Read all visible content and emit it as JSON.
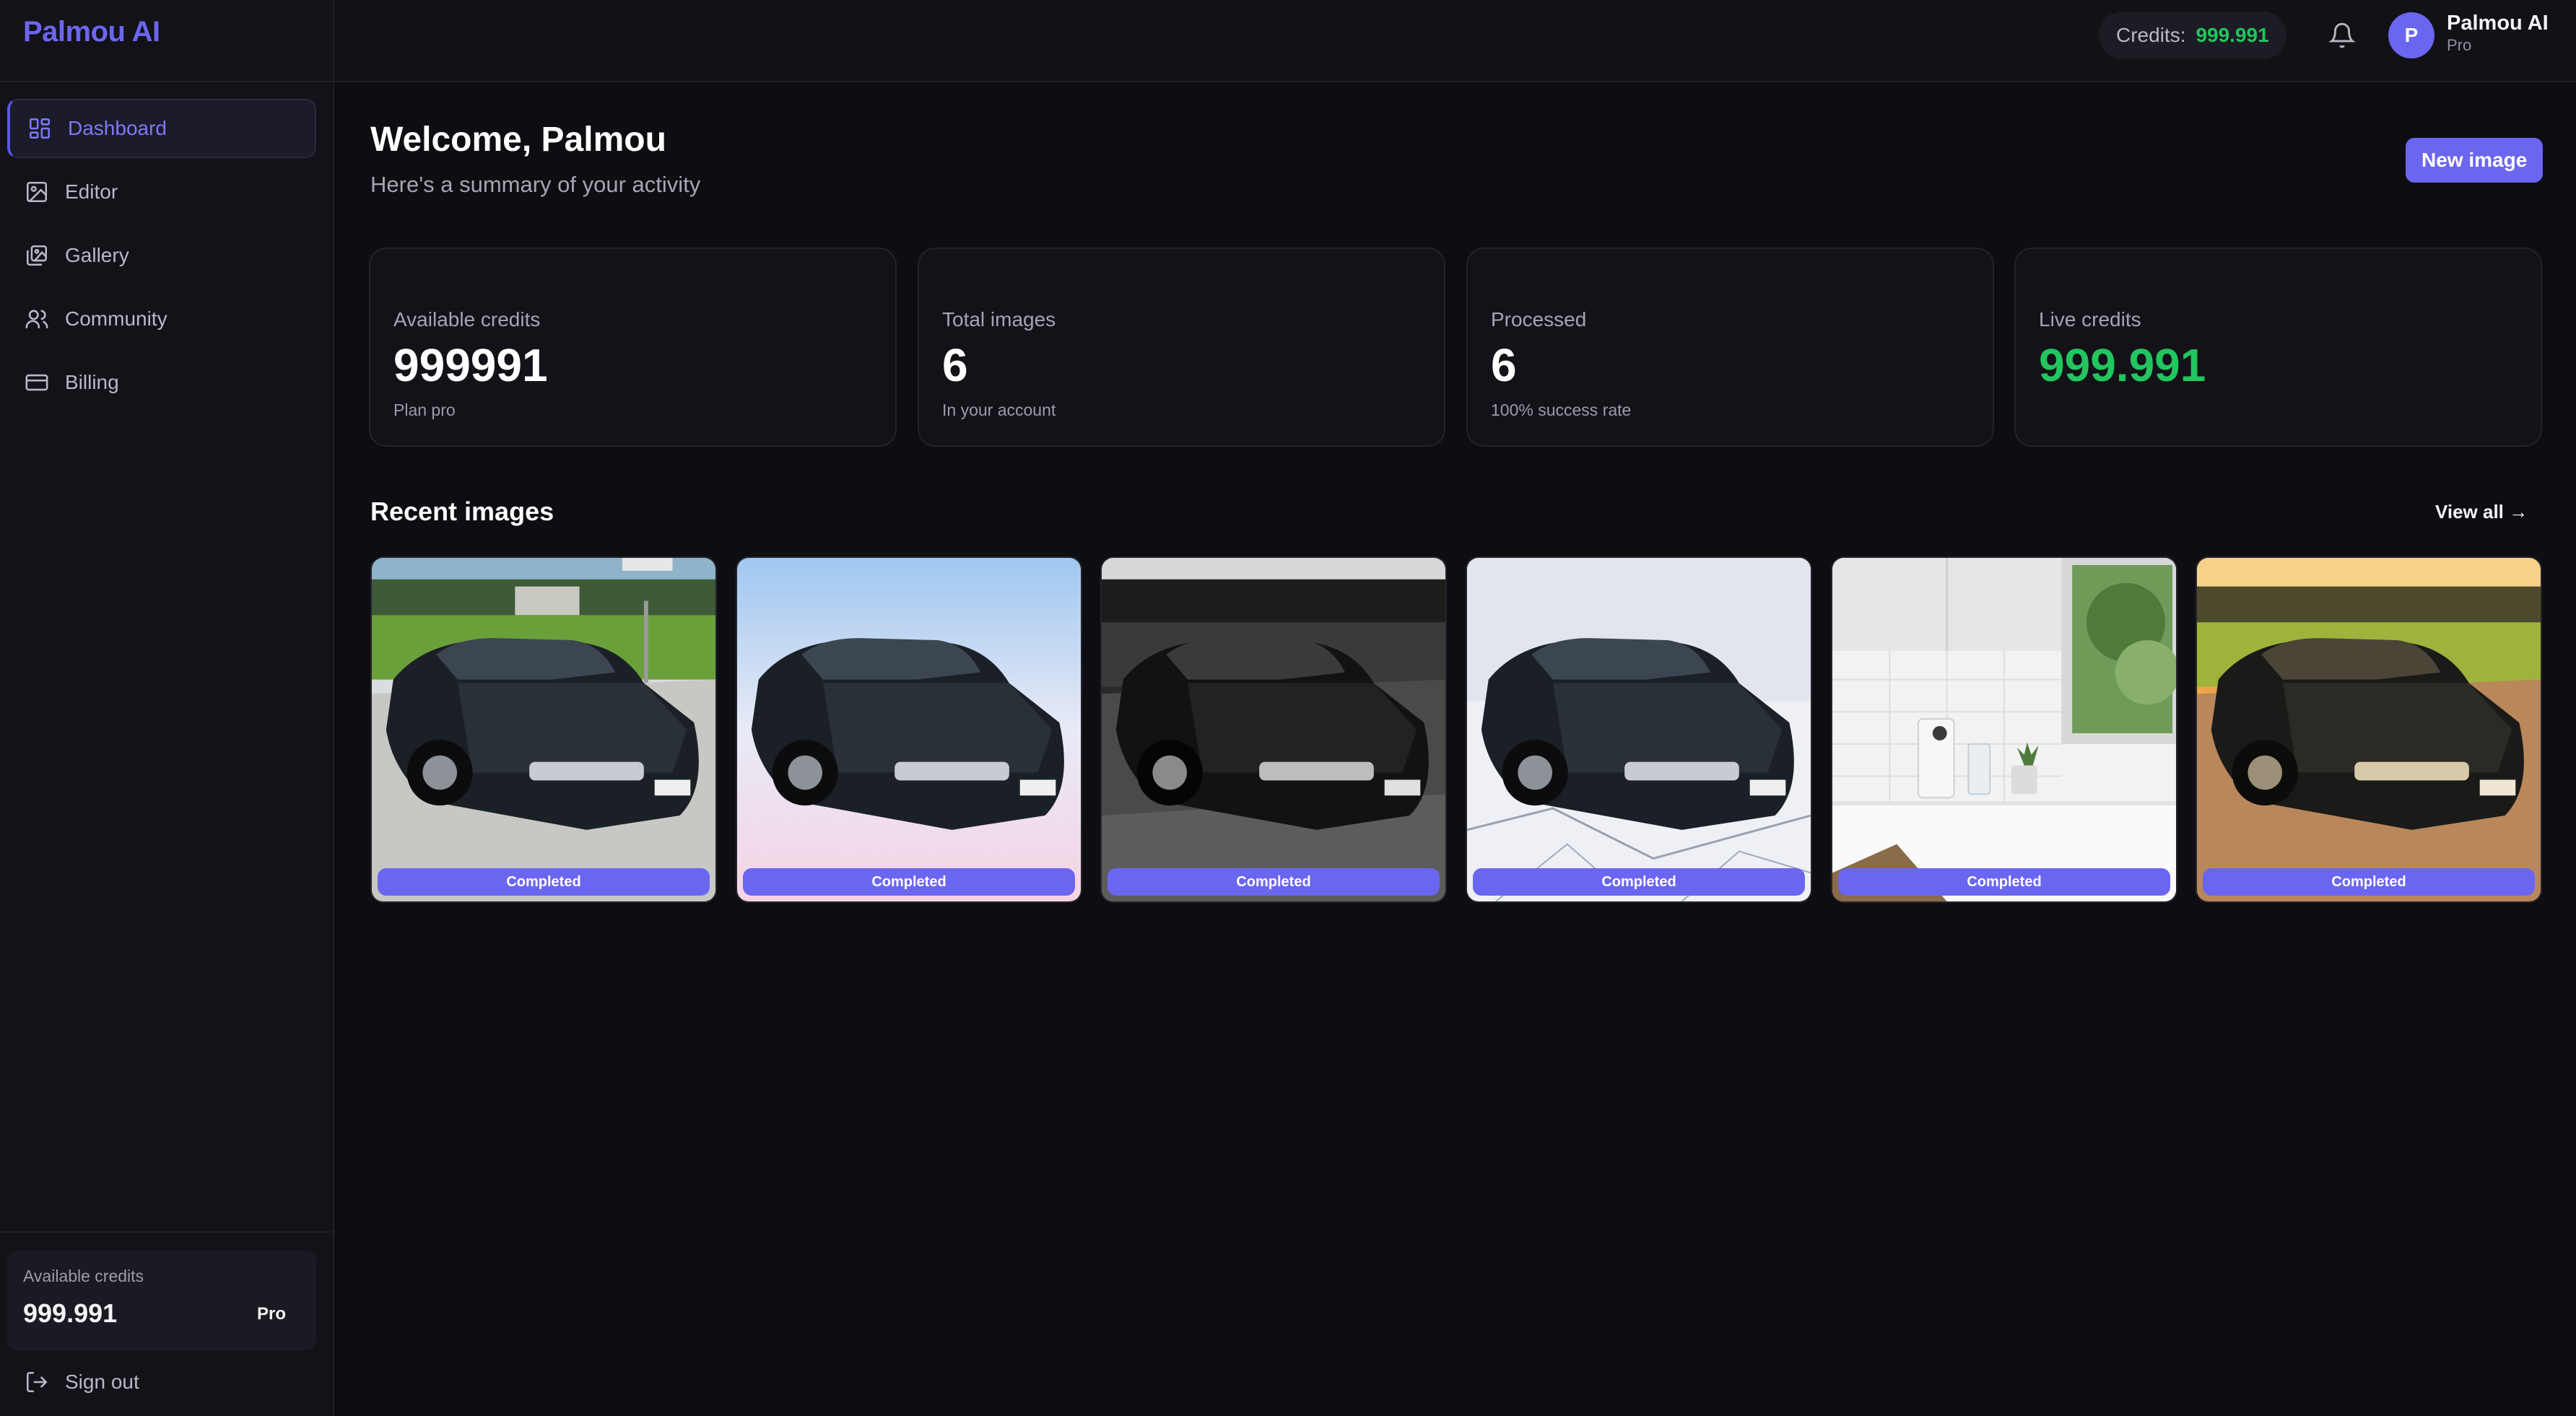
{
  "app": {
    "brand": "Palmou AI"
  },
  "sidebar": {
    "items": [
      {
        "label": "Dashboard",
        "icon": "dashboard-icon",
        "active": true
      },
      {
        "label": "Editor",
        "icon": "image-icon",
        "active": false
      },
      {
        "label": "Gallery",
        "icon": "images-icon",
        "active": false
      },
      {
        "label": "Community",
        "icon": "users-icon",
        "active": false
      },
      {
        "label": "Billing",
        "icon": "credit-card-icon",
        "active": false
      }
    ],
    "credits_card": {
      "label": "Available credits",
      "value": "999.991",
      "plan": "Pro"
    },
    "sign_out": "Sign out"
  },
  "topbar": {
    "credits_label": "Credits:",
    "credits_value": "999.991",
    "user": {
      "initial": "P",
      "name": "Palmou AI",
      "plan": "Pro"
    }
  },
  "main": {
    "welcome": "Welcome, Palmou",
    "subtitle": "Here's a summary of your activity",
    "new_image_button": "New image",
    "stats": [
      {
        "label": "Available credits",
        "value": "999991",
        "sub": "Plan pro"
      },
      {
        "label": "Total images",
        "value": "6",
        "sub": "In your account"
      },
      {
        "label": "Processed",
        "value": "6",
        "sub": "100% success rate"
      },
      {
        "label": "Live credits",
        "value": "999.991",
        "sub": ""
      }
    ],
    "recent_title": "Recent images",
    "view_all": "View all →",
    "recent_images": [
      {
        "scene": "car-on-street-sunny",
        "status": "Completed"
      },
      {
        "scene": "car-on-pastel-gradient",
        "status": "Completed"
      },
      {
        "scene": "car-black-and-white",
        "status": "Completed"
      },
      {
        "scene": "car-on-white-marble",
        "status": "Completed"
      },
      {
        "scene": "white-kitchen-counter",
        "status": "Completed"
      },
      {
        "scene": "car-golden-hour",
        "status": "Completed"
      }
    ]
  },
  "colors": {
    "accent": "#6b66f0",
    "positive": "#22c55e",
    "background": "#0d0d12"
  }
}
